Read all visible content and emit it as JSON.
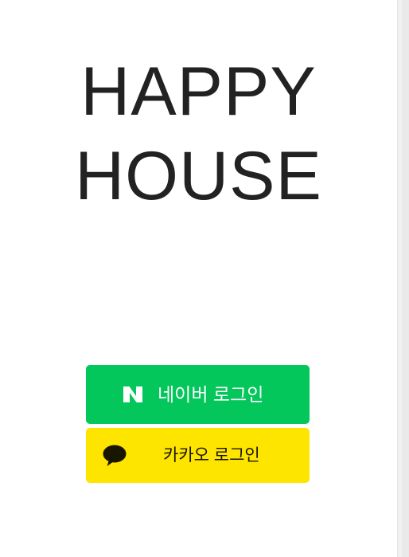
{
  "app": {
    "title_line1": "HAPPY",
    "title_line2": "HOUSE"
  },
  "login": {
    "naver_label": "네이버 로그인",
    "kakao_label": "카카오 로그인",
    "naver_color": "#03c75a",
    "kakao_color": "#fee500"
  },
  "icons": {
    "naver": "naver-n-logo",
    "kakao": "kakao-speech-bubble"
  }
}
